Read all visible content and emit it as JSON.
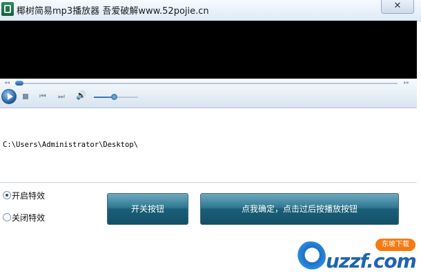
{
  "window": {
    "title": "椰树简易mp3播放器 吾爱破解www.52pojie.cn",
    "close_label": "✕"
  },
  "player": {
    "seek_back_glyph": "◂◂",
    "seek_fwd_glyph": "▸▸",
    "prev_glyph": "⏮",
    "next_glyph": "⏭",
    "volume_glyph": "🔊",
    "volume_level": 0.45
  },
  "path_text": "C:\\Users\\Administrator\\Desktop\\",
  "effects": {
    "on_label": "开启特效",
    "off_label": "关闭特效",
    "selected": "on"
  },
  "buttons": {
    "toggle_label": "开关按钮",
    "confirm_label": "点我确定，点击过后按播放按钮"
  },
  "watermark": {
    "text": "uzzf.com",
    "badge": "东坡下载"
  },
  "colors": {
    "accent": "#1f5c9e",
    "button": "#1b5f78",
    "badge": "#f57a12"
  }
}
